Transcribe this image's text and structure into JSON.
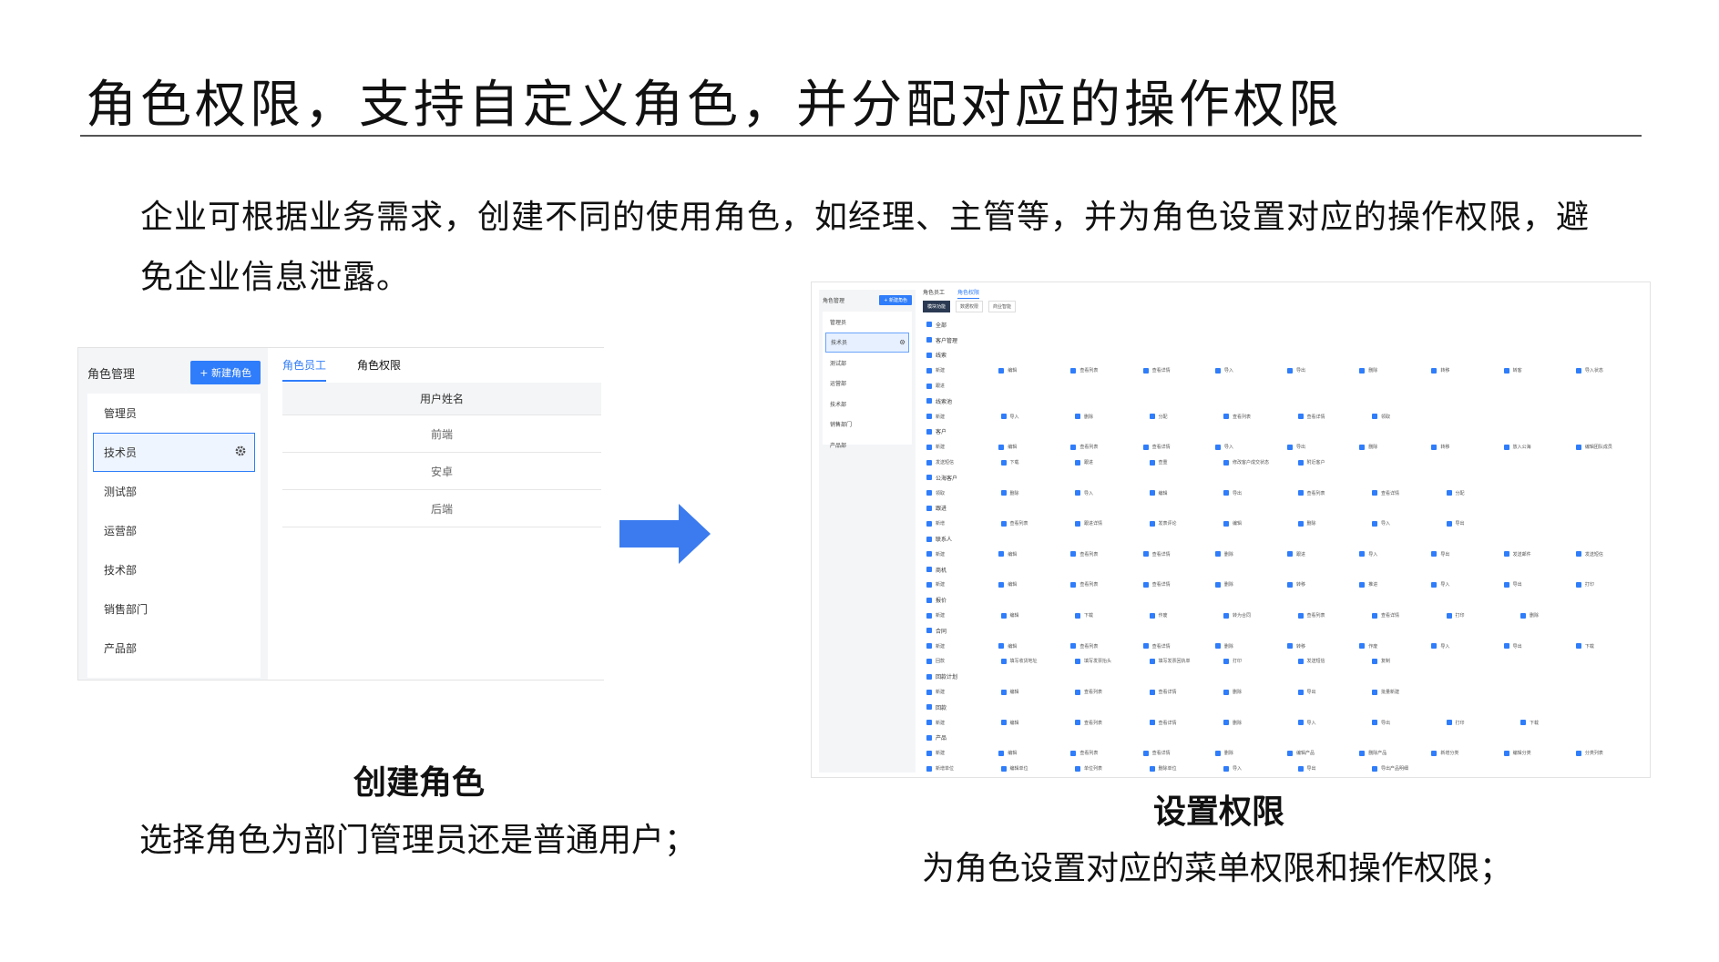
{
  "title": "角色权限，支持自定义角色，并分配对应的操作权限",
  "intro": "企业可根据业务需求，创建不同的使用角色，如经理、主管等，并为角色设置对应的操作权限，避免企业信息泄露。",
  "left_panel": {
    "header": "角色管理",
    "new_button": "+ 新建角色",
    "roles": [
      "管理员",
      "技术员",
      "测试部",
      "运营部",
      "技术部",
      "销售部门",
      "产品部"
    ],
    "selected_role_index": 1,
    "tabs": [
      "角色员工",
      "角色权限"
    ],
    "active_tab_index": 0,
    "table": {
      "header": "用户姓名",
      "rows": [
        "前端",
        "安卓",
        "后端"
      ]
    }
  },
  "right_panel": {
    "header": "角色管理",
    "new_button": "+ 新建角色",
    "roles": [
      "管理员",
      "技术员",
      "测试部",
      "运营部",
      "技术部",
      "销售部门",
      "产品部"
    ],
    "selected_role_index": 1,
    "tabs": [
      "角色员工",
      "角色权限"
    ],
    "active_tab_index": 1,
    "subtabs": [
      "模块功能",
      "数据权限",
      "商业智能"
    ],
    "active_subtab_index": 0,
    "permissions": [
      {
        "group": "全部",
        "rows": []
      },
      {
        "group": "客户管理",
        "rows": []
      },
      {
        "group": "线索",
        "rows": [
          [
            "新建",
            "编辑",
            "查看列表",
            "查看详情",
            "导入",
            "导出",
            "删除",
            "转移",
            "转客",
            "导入状态"
          ],
          [
            "跟进"
          ]
        ]
      },
      {
        "group": "线索池",
        "rows": [
          [
            "新建",
            "导入",
            "删除",
            "分配",
            "查看列表",
            "查看详情",
            "领取"
          ]
        ]
      },
      {
        "group": "客户",
        "rows": [
          [
            "新建",
            "编辑",
            "查看列表",
            "查看详情",
            "导入",
            "导出",
            "删除",
            "转移",
            "放入公海",
            "编辑团队成员"
          ],
          [
            "发送短信",
            "下载",
            "跟进",
            "查重",
            "修改客户成交状态",
            "附近客户"
          ]
        ]
      },
      {
        "group": "公海客户",
        "rows": [
          [
            "领取",
            "删除",
            "导入",
            "编辑",
            "导出",
            "查看列表",
            "查看详情",
            "分配"
          ]
        ]
      },
      {
        "group": "跟进",
        "rows": [
          [
            "新增",
            "查看列表",
            "跟进详情",
            "发表评论",
            "编辑",
            "删除",
            "导入",
            "导出"
          ]
        ]
      },
      {
        "group": "联系人",
        "rows": [
          [
            "新建",
            "编辑",
            "查看列表",
            "查看详情",
            "删除",
            "跟进",
            "导入",
            "导出",
            "发送邮件",
            "发送短信"
          ]
        ]
      },
      {
        "group": "商机",
        "rows": [
          [
            "新建",
            "编辑",
            "查看列表",
            "查看详情",
            "删除",
            "转移",
            "推进",
            "导入",
            "导出",
            "打印"
          ]
        ]
      },
      {
        "group": "报价",
        "rows": [
          [
            "新建",
            "编辑",
            "下载",
            "作废",
            "转为合同",
            "查看列表",
            "查看详情",
            "打印",
            "删除"
          ]
        ]
      },
      {
        "group": "合同",
        "rows": [
          [
            "新建",
            "编辑",
            "查看列表",
            "查看详情",
            "删除",
            "转移",
            "作废",
            "导入",
            "导出",
            "下载"
          ],
          [
            "回款",
            "填写收货地址",
            "填写发票抬头",
            "填写发票回执单",
            "打印",
            "发送短信",
            "复制"
          ]
        ]
      },
      {
        "group": "回款计划",
        "rows": [
          [
            "新建",
            "编辑",
            "查看列表",
            "查看详情",
            "删除",
            "导出",
            "批量新建"
          ]
        ]
      },
      {
        "group": "回款",
        "rows": [
          [
            "新建",
            "编辑",
            "查看列表",
            "查看详情",
            "删除",
            "导入",
            "导出",
            "打印",
            "下载"
          ]
        ]
      },
      {
        "group": "产品",
        "rows": [
          [
            "新建",
            "编辑",
            "查看列表",
            "查看详情",
            "删除",
            "编辑产品",
            "删除产品",
            "新增分类",
            "编辑分类",
            "分类列表"
          ],
          [
            "新增单位",
            "编辑单位",
            "单位列表",
            "删除单位",
            "导入",
            "导出",
            "导出产品明细"
          ]
        ]
      }
    ]
  },
  "captions": {
    "left_heading": "创建角色",
    "left_text": "选择角色为部门管理员还是普通用户；",
    "right_heading": "设置权限",
    "right_text": "为角色设置对应的菜单权限和操作权限；"
  },
  "colors": {
    "accent": "#2f7dfa",
    "arrow": "#3b7bef",
    "dark_tab": "#2b3a52"
  }
}
